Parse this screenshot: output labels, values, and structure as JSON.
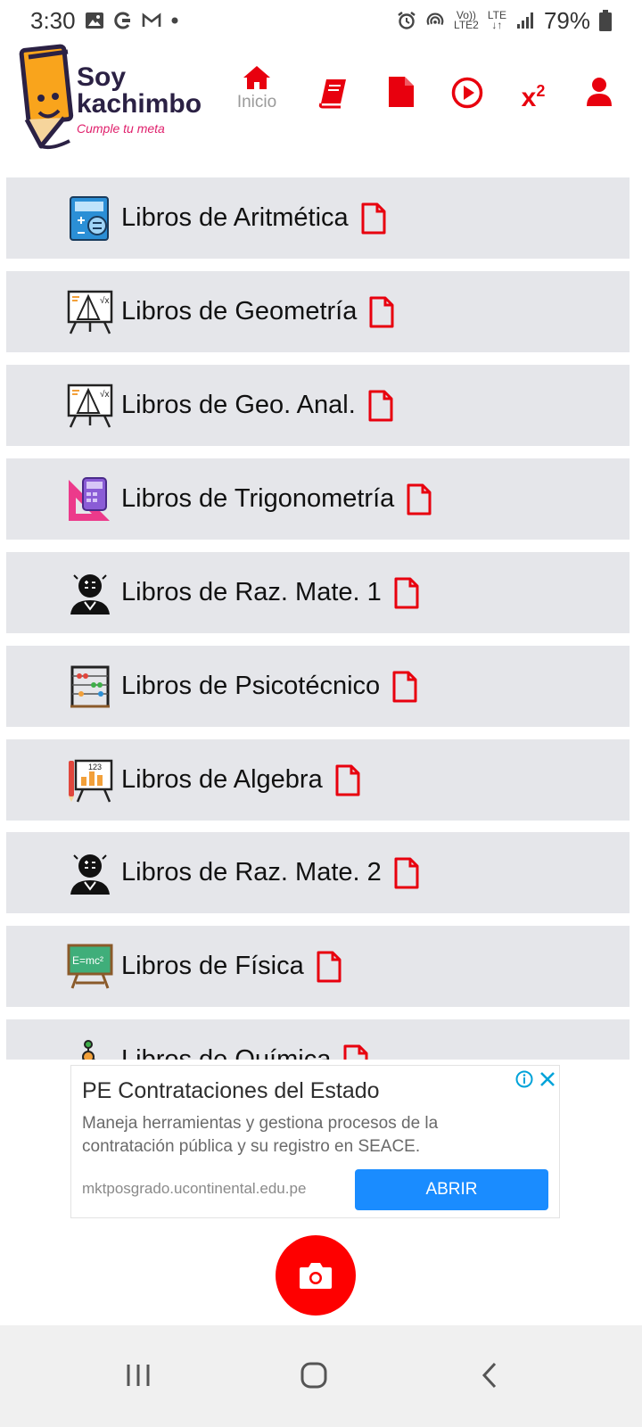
{
  "status_bar": {
    "time": "3:30",
    "net_top": "Vo))",
    "net_bottom": "LTE2",
    "lte_top": "LTE",
    "battery": "79%"
  },
  "header": {
    "logo_line1": "Soy",
    "logo_line2": "kachimbo",
    "logo_tagline": "Cumple tu meta",
    "nav": {
      "home_label": "Inicio",
      "superscript_icon_text": "x",
      "superscript_icon_power": "2"
    }
  },
  "colors": {
    "accent": "#e8000e",
    "list_bg": "#e5e6ea",
    "ad_button": "#1a8cff",
    "fab": "#fe0000"
  },
  "list": {
    "items": [
      {
        "label": "Libros de Aritmética",
        "icon": "calculator-icon"
      },
      {
        "label": "Libros de Geometría",
        "icon": "geometry-board-icon"
      },
      {
        "label": "Libros de Geo. Anal.",
        "icon": "geometry-board-icon"
      },
      {
        "label": "Libros de Trigonometría",
        "icon": "set-square-calculator-icon"
      },
      {
        "label": "Libros de Raz. Mate. 1",
        "icon": "thinking-head-icon"
      },
      {
        "label": "Libros de Psicotécnico",
        "icon": "abacus-icon"
      },
      {
        "label": "Libros de Algebra",
        "icon": "chart-board-icon"
      },
      {
        "label": "Libros de Raz. Mate. 2",
        "icon": "thinking-head-icon"
      },
      {
        "label": "Libros de Física",
        "icon": "chalkboard-emc2-icon"
      },
      {
        "label": "Libros de Química",
        "icon": "molecule-icon"
      }
    ]
  },
  "ad": {
    "title": "PE Contrataciones del Estado",
    "description": "Maneja herramientas y gestiona procesos de la contratación pública y su registro en SEACE.",
    "url": "mktposgrado.ucontinental.edu.pe",
    "button_label": "ABRIR"
  }
}
